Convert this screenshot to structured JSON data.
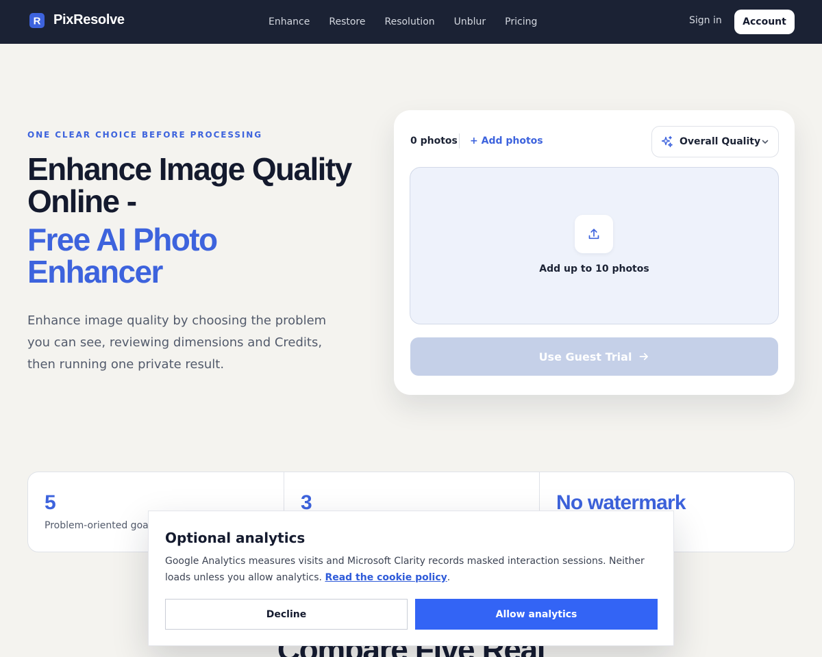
{
  "brand": {
    "name": "PixResolve",
    "logo_letter": "R",
    "accent": "#3d63dd"
  },
  "nav": {
    "links": [
      "Enhance",
      "Restore",
      "Resolution",
      "Unblur",
      "Pricing"
    ],
    "signin": "Sign in",
    "account": "Account"
  },
  "hero": {
    "eyebrow": "ONE CLEAR CHOICE BEFORE PROCESSING",
    "title_line_dark": "Enhance Image Quality Online -",
    "title_line_blue": "Free AI Photo Enhancer",
    "description": "Enhance image quality by choosing the problem you can see, reviewing dimensions and Credits, then running one private result."
  },
  "uploader": {
    "photo_count": "0 photos",
    "add_photos": "+ Add photos",
    "mode_select": "Overall Quality",
    "dropzone_label": "Add up to 10 photos",
    "submit": "Use Guest Trial",
    "icons": {
      "mode": "sparkle-icon",
      "dropzone": "upload-icon",
      "submit": "arrow-right-icon",
      "select": "chevron-down-icon"
    }
  },
  "stats": [
    {
      "value": "5",
      "label": "Problem-oriented goals"
    },
    {
      "value": "3",
      "label": ""
    },
    {
      "value": "No watermark",
      "label": ""
    }
  ],
  "section": {
    "title": "Compare Five Real"
  },
  "cookie": {
    "title": "Optional analytics",
    "text": "Google Analytics measures visits and Microsoft Clarity records masked interaction sessions. Neither loads unless you allow analytics.",
    "link": "Read the cookie policy",
    "link_suffix": ".",
    "decline": "Decline",
    "allow": "Allow analytics",
    "allow_color": "#3364f5"
  }
}
